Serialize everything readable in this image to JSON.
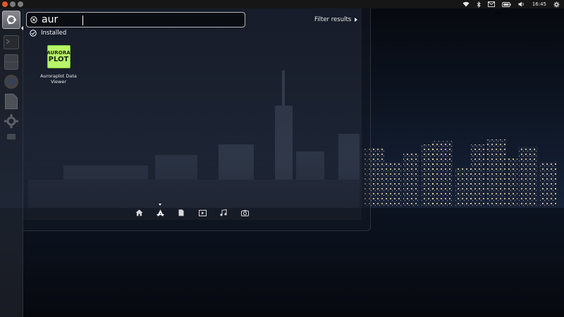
{
  "top_panel": {
    "clock": "16:45"
  },
  "search": {
    "value": "aur",
    "filter_label": "Filter results"
  },
  "results": {
    "category_label": "Installed",
    "apps": [
      {
        "name": "Auroraplot Data Viewer",
        "icon_line1": "AURORA",
        "icon_line2": "PLOT",
        "icon_color": "#b8f56a"
      }
    ]
  },
  "lenses": [
    {
      "icon": "home-icon"
    },
    {
      "icon": "applications-icon",
      "active": true
    },
    {
      "icon": "files-icon"
    },
    {
      "icon": "video-icon"
    },
    {
      "icon": "music-icon"
    },
    {
      "icon": "photos-icon"
    }
  ],
  "colors": {
    "accent": "#e0582a",
    "app_icon_green": "#b8f56a"
  }
}
